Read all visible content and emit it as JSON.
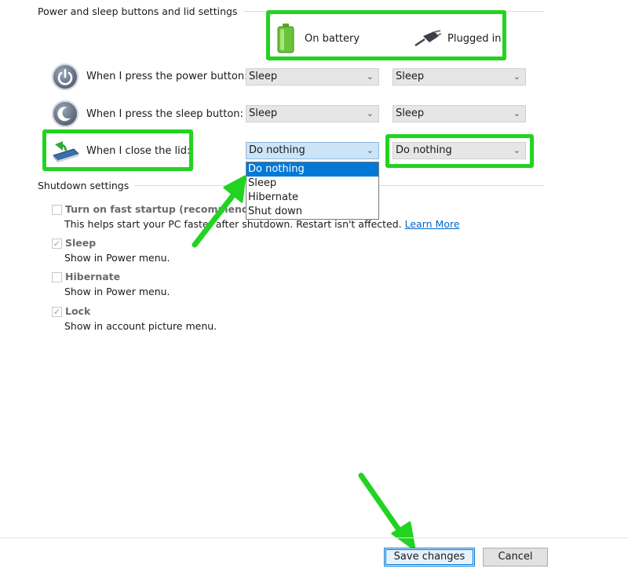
{
  "power_section": {
    "title": "Power and sleep buttons and lid settings",
    "on_battery": "On battery",
    "plugged_in": "Plugged in",
    "rows": [
      {
        "label": "When I press the power button:",
        "battery": "Sleep",
        "plugged": "Sleep"
      },
      {
        "label": "When I press the sleep button:",
        "battery": "Sleep",
        "plugged": "Sleep"
      },
      {
        "label": "When I close the lid:",
        "battery": "Do nothing",
        "plugged": "Do nothing"
      }
    ],
    "dropdown_options": [
      "Do nothing",
      "Sleep",
      "Hibernate",
      "Shut down"
    ]
  },
  "shutdown_section": {
    "title": "Shutdown settings",
    "options": [
      {
        "title": "Turn on fast startup (recommended)",
        "desc": "This helps start your PC faster after shutdown. Restart isn't affected.",
        "link": "Learn More",
        "checked": false
      },
      {
        "title": "Sleep",
        "desc": "Show in Power menu.",
        "checked": true
      },
      {
        "title": "Hibernate",
        "desc": "Show in Power menu.",
        "checked": false
      },
      {
        "title": "Lock",
        "desc": "Show in account picture menu.",
        "checked": true
      }
    ]
  },
  "footer": {
    "save_label": "Save changes",
    "cancel_label": "Cancel"
  },
  "colors": {
    "highlight": "#22d322",
    "selection": "#0078d7",
    "link": "#0066cc"
  }
}
